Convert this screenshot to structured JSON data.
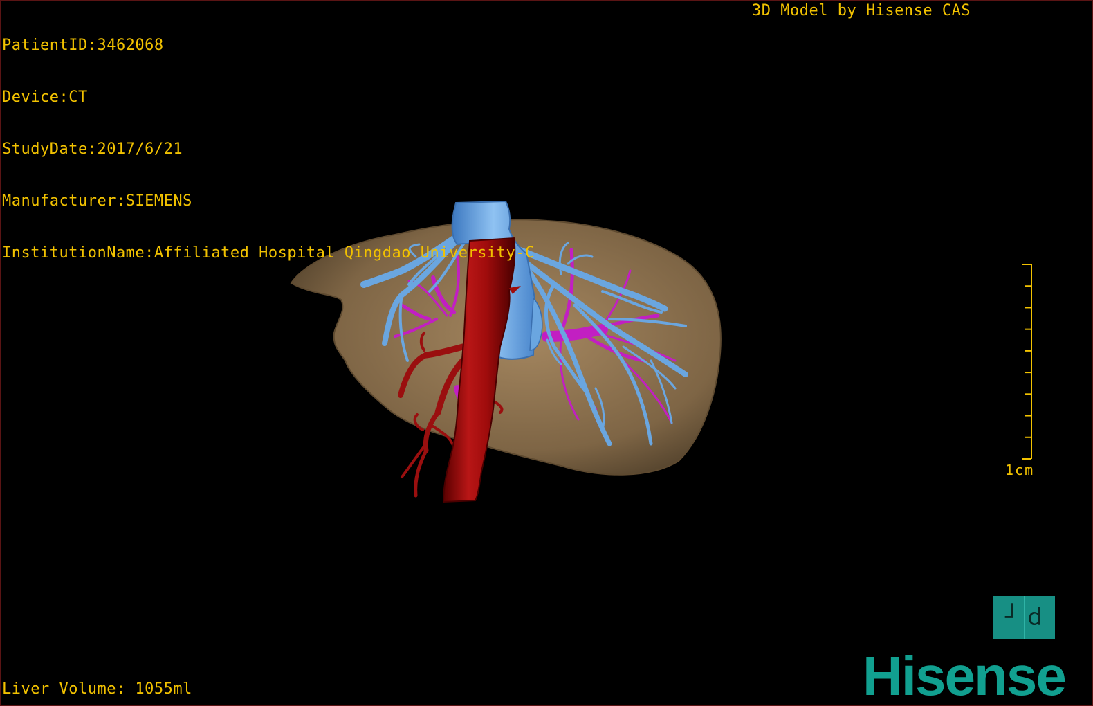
{
  "dicom_info": {
    "patient_id": "PatientID:3462068",
    "device": "Device:CT",
    "study_date": "StudyDate:2017/6/21",
    "manufacturer": "Manufacturer:SIEMENS",
    "institution": "InstitutionName:Affiliated Hospital Qingdao University-C"
  },
  "model_credit": "3D Model by Hisense CAS",
  "liver_volume": "Liver Volume: 1055ml",
  "scale_bar": {
    "label": "1cm",
    "ticks": 10
  },
  "orientation_cube": {
    "left_face": "┘",
    "right_face": "d"
  },
  "brand": "Hisense",
  "colors": {
    "overlay_text": "#f2c200",
    "liver": "#8c7150",
    "hepatic_vein": "#6aa6e0",
    "portal_vein": "#cc22cc",
    "vena_cava": "#a30d0d",
    "brand": "#11a090",
    "background": "#000000"
  },
  "structures": [
    "liver",
    "hepatic-veins",
    "portal-veins",
    "inferior-vena-cava",
    "arteries"
  ]
}
